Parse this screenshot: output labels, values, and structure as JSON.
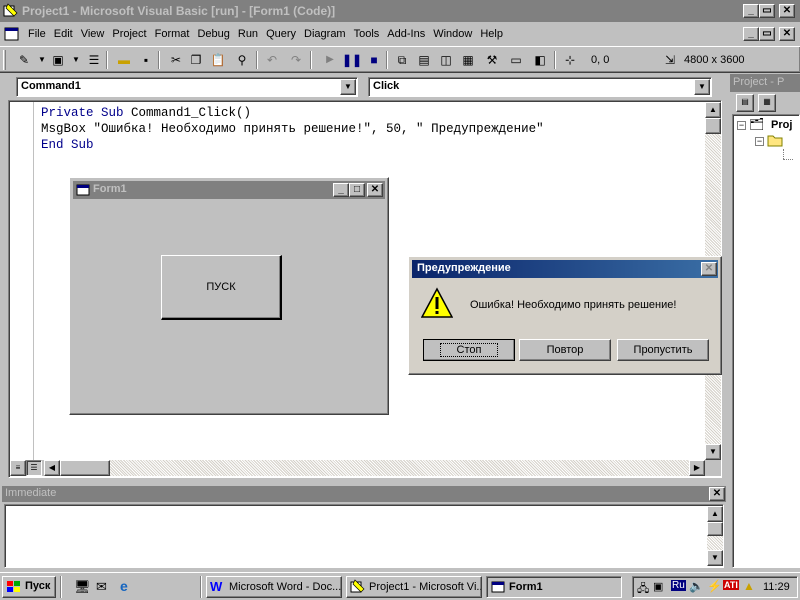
{
  "window": {
    "title": "Project1 - Microsoft Visual Basic [run] - [Form1 (Code)]"
  },
  "menu": [
    "File",
    "Edit",
    "View",
    "Project",
    "Format",
    "Debug",
    "Run",
    "Query",
    "Diagram",
    "Tools",
    "Add-Ins",
    "Window",
    "Help"
  ],
  "toolbar": {
    "position": "0, 0",
    "size": "4800 x 3600"
  },
  "code_window": {
    "object_combo": "Command1",
    "procedure_combo": "Click",
    "lines": [
      "Private Sub Command1_Click()",
      "MsgBox \"Ошибка! Необходимо принять решение!\", 50, \" Предупреждение\"",
      "End Sub"
    ]
  },
  "form1": {
    "title": "Form1",
    "button_label": "ПУСК"
  },
  "msgbox": {
    "title": "Предупреждение",
    "message": "Ошибка! Необходимо принять решение!",
    "buttons": [
      "Стоп",
      "Повтор",
      "Пропустить"
    ]
  },
  "project_panel": {
    "title": "Project - P",
    "root_label": "Proj"
  },
  "immediate": {
    "title": "Immediate"
  },
  "taskbar": {
    "start_label": "Пуск",
    "tasks": [
      "Microsoft Word - Doc...",
      "Project1 - Microsoft Vi...",
      "Form1"
    ],
    "lang": "Ru",
    "clock": "11:29"
  },
  "colors": {
    "active_title": "#0a246a",
    "inactive_title": "#808080",
    "code_keyword": "#00008b"
  }
}
